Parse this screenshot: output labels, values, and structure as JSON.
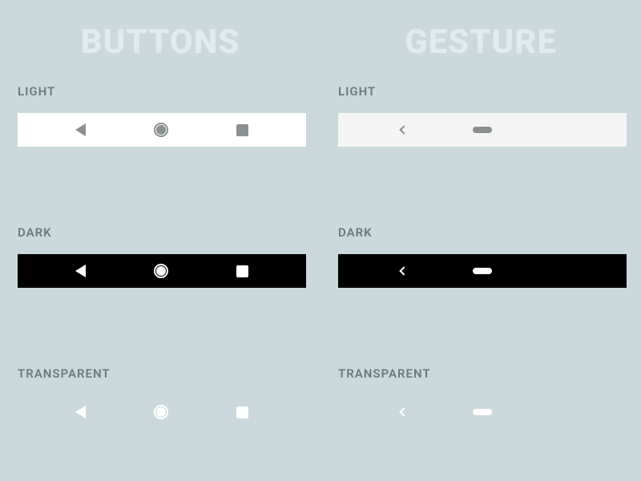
{
  "columns": {
    "buttons": {
      "title": "BUTTONS"
    },
    "gesture": {
      "title": "GESTURE"
    }
  },
  "variants": {
    "light": "LIGHT",
    "dark": "DARK",
    "transparent": "TRANSPARENT"
  }
}
